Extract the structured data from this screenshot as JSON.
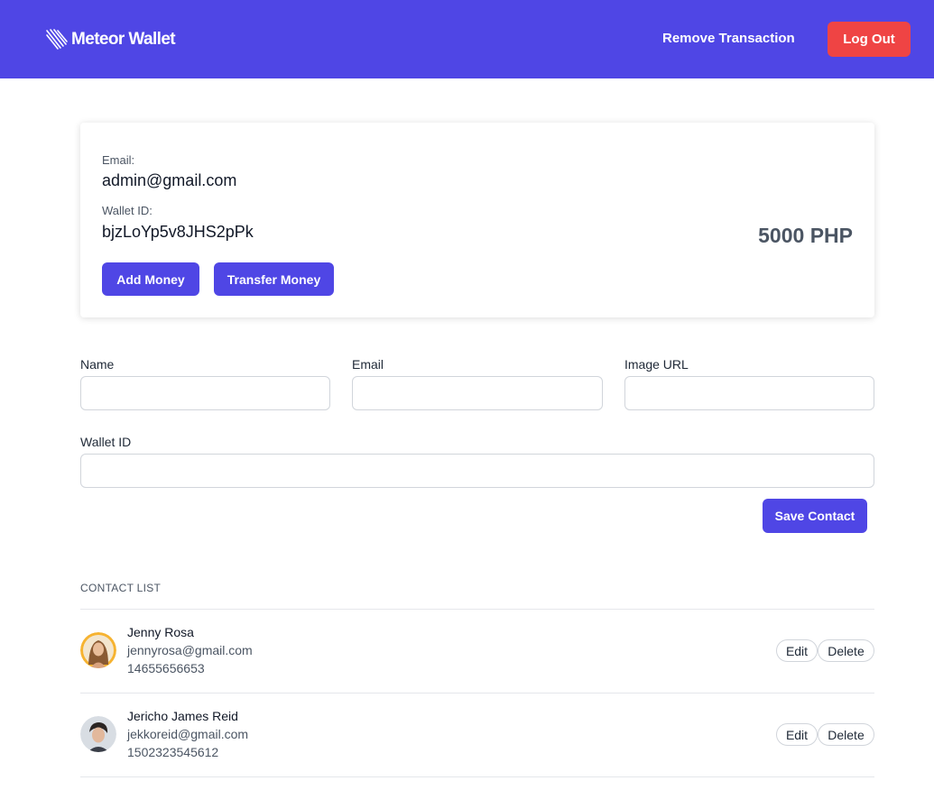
{
  "navbar": {
    "brand": "Meteor Wallet",
    "remove_transaction": "Remove Transaction",
    "logout": "Log Out",
    "color": "#4f46e5",
    "logout_color": "#ef4444"
  },
  "account": {
    "email_label": "Email:",
    "email": "admin@gmail.com",
    "wallet_label": "Wallet ID:",
    "wallet_id": "bjzLoYp5v8JHS2pPk",
    "balance": "5000 PHP",
    "add_money": "Add Money",
    "transfer_money": "Transfer Money"
  },
  "form": {
    "name_label": "Name",
    "name_value": "",
    "email_label": "Email",
    "email_value": "",
    "image_label": "Image URL",
    "image_value": "",
    "wallet_label": "Wallet ID",
    "wallet_value": "",
    "save": "Save Contact"
  },
  "contacts": {
    "heading": "CONTACT LIST",
    "items": [
      {
        "name": "Jenny Rosa",
        "email": "jennyrosa@gmail.com",
        "phone": "14655656653",
        "edit": "Edit",
        "delete": "Delete"
      },
      {
        "name": "Jericho James Reid",
        "email": "jekkoreid@gmail.com",
        "phone": "1502323545612",
        "edit": "Edit",
        "delete": "Delete"
      }
    ]
  }
}
